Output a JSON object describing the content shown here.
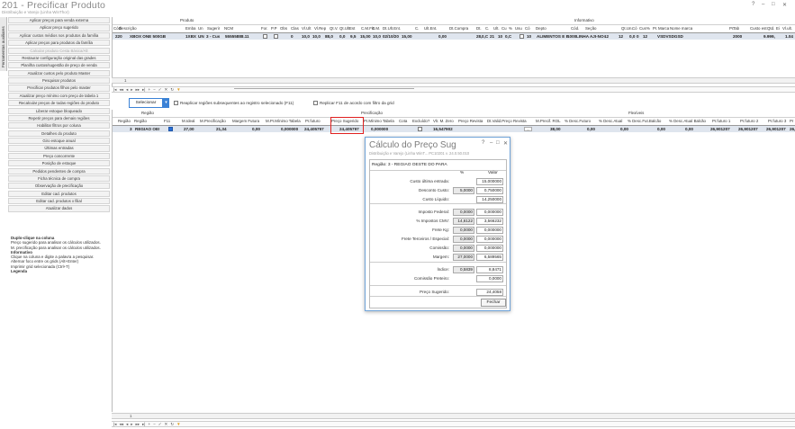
{
  "app": {
    "title": "201 - Precificar Produto",
    "subtitle": "Distribuição e Varejo (Linha WinThor)",
    "help_icon": "?",
    "ctrl_min": "–",
    "ctrl_max": "□",
    "ctrl_close": "✕"
  },
  "side_tab": "Ferramentas auxiliares",
  "sidebar": {
    "items": [
      {
        "label": "Aplicar preços para venda externa",
        "enabled": true
      },
      {
        "label": "Aplicar preço sugerido",
        "enabled": true
      },
      {
        "label": "Aplicar custos médios nos produtos da família",
        "enabled": true
      },
      {
        "label": "Aplicar preços para produtos da família",
        "enabled": true
      },
      {
        "label": "Calcular produto Cesta Básica/Alt",
        "enabled": false
      },
      {
        "label": "Restaurar configuração original das grades",
        "enabled": true
      },
      {
        "label": "Planilha custos/sugestão de preço de venda",
        "enabled": true
      },
      {
        "label": "Atualizar custos pelo produto Master",
        "enabled": true
      },
      {
        "label": "Pesquisar produtos",
        "enabled": true
      },
      {
        "label": "Precificar produtos filhos pelo master",
        "enabled": true
      },
      {
        "label": "Atualizar preço mínimo com preço de tabela 1",
        "enabled": true
      },
      {
        "label": "Recalcular preços de todas regiões do produto",
        "enabled": true
      },
      {
        "label": "Liberar estoque bloqueado",
        "enabled": true
      },
      {
        "label": "Repetir preços para demais regiões",
        "enabled": true
      },
      {
        "label": "Habilitar filtros por coluna",
        "enabled": true
      },
      {
        "label": "Detalhes do produto",
        "enabled": true
      },
      {
        "label": "Giro estoque anual",
        "enabled": true
      },
      {
        "label": "Últimas entradas",
        "enabled": true
      },
      {
        "label": "Preço concorrente",
        "enabled": true
      },
      {
        "label": "Posição de estoque",
        "enabled": true
      },
      {
        "label": "Pedidos pendentes de compra",
        "enabled": true
      },
      {
        "label": "Ficha técnica de compra",
        "enabled": true
      },
      {
        "label": "Observação de precificação",
        "enabled": true
      },
      {
        "label": "Editar cad. produtos",
        "enabled": true
      },
      {
        "label": "Editar cad. produtos x filial",
        "enabled": true
      },
      {
        "label": "Atualizar dados",
        "enabled": true
      }
    ],
    "help_title": "Duplo-clique na coluna",
    "help_line1": "Preço sugerido para analisar os cálculos utilizados.",
    "help_line2": "M. precificação para analisar os cálculos utilizados.",
    "info_title": "Informativo",
    "info_line1": "Clique na coluna e digite a palavra a pesquisar.",
    "info_line2": "Alternar foco entre os grids (Alt+Enter)",
    "info_line3": "Imprimir grid selecionada (Ctrl+T)",
    "legend_title": "Legenda"
  },
  "product_grid": {
    "group_produto": "Produto",
    "group_informativo": "Informativo",
    "headers": [
      "Códi",
      "Descrição",
      "Emba",
      "Un",
      "Sugerir",
      "NCM",
      "For.",
      "P.P",
      "Obs",
      "Clas",
      "Vl.Ult",
      "Vl.Rep",
      "Qt.V.",
      "Qt.Ult",
      "Est",
      "C.M.Fin",
      "C.M.",
      "Dt.Ult.Ent.",
      "C.",
      "Ult.Ent.",
      "Dt.Compra",
      "Dt.",
      "C.",
      "Ult.",
      "Cu",
      "%",
      "Usu",
      "Có",
      "Depto",
      "Cód.",
      "Seção",
      "Qt.Un.",
      "Có",
      "Cus",
      "%",
      "Pr.",
      "Marca",
      "Nome marca",
      "Pr.",
      "Tab",
      "Custo est",
      "Qtd.",
      "Ei",
      "Vl.ult."
    ],
    "row": [
      "220",
      "XBOX ONE 500GB",
      "1XBX",
      "UN",
      "3 - Cus",
      "55555888.11",
      "0",
      "10,0",
      "10,0",
      "88,0",
      "0,0",
      "9,5",
      "15,00",
      "10,0",
      "02/10/20",
      "15,00",
      "0,00",
      "28,",
      "0,C",
      "21",
      "10",
      "0,C",
      "10",
      "ALIMENTOS E E",
      "1000",
      "LINHA AJI-NO-",
      "12",
      "12",
      "0,0",
      "0",
      "12",
      "VSDVSDGSD",
      "2000",
      "9.999,",
      "1.04"
    ],
    "nav_count": "1"
  },
  "options": {
    "button": "Selecionar",
    "dropdown_arrow": "▾",
    "opt1": "Reaplicar regiões subsequentes ao registro selecionado (F11)",
    "opt2": "Replicar F11 de acordo com filtro da grid"
  },
  "region_grid": {
    "group_regiao": "Região",
    "group_precificacao": "Precificação",
    "group_flexiveis": "Flexíveis",
    "headers": [
      "Região",
      "Região",
      "F11",
      "M.Ideal",
      "M.Precificação",
      "Margem Futura",
      "M.Pr.Mínimo Tabela",
      "Pr.futuro",
      "Preço Sugerido",
      "Pr.Mínimo Tabela",
      "Cota",
      "Excluído?",
      "Vlr. M. Zero",
      "Preço Revista",
      "Dt.Valid.Preço Revista",
      "M.Precif. ROL",
      "% Desc.Futuro",
      "% Desc.Atual",
      "% Desc.Fut.Balcão",
      "% Desc.Atual Balcão",
      "Pr.futuro 1",
      "Pr.futuro 2",
      "Pr.futuro 3",
      "Pr"
    ],
    "row": [
      "3",
      "REGIAO OE!",
      "27,00",
      "21,34",
      "0,00",
      "0,000000",
      "24,405797",
      "24,405797",
      "0,000000",
      "16,547902",
      "38,00",
      "0,00",
      "0,00",
      "0,00",
      "0,00",
      "26,901207",
      "26,901207",
      "26,901207",
      "26,"
    ],
    "nav_count": "1"
  },
  "dialog": {
    "title": "Cálculo do Preço Sug",
    "subtitle": "Distribuição e Varejo (Linha WinT...",
    "code": "PC10201",
    "version": "v. 24.0.50.010",
    "region_label": "Região: 3 - REGIAO OESTE DO PARA",
    "col_pct": "%",
    "col_valor": "Valor",
    "rows": [
      {
        "label": "Custo última entrada:",
        "pct": "",
        "valor": "15,000000"
      },
      {
        "label": "Desconto Custo:",
        "pct": "5,0000",
        "valor": "0,750000"
      },
      {
        "label": "Custo Líquido:",
        "pct": "",
        "valor": "14,250000"
      },
      {
        "label": "Imposto Federal:",
        "pct": "0,0000",
        "valor": "0,000000"
      },
      {
        "label": "% Impostos CMV:",
        "pct": "14,6122",
        "valor": "3,566232"
      },
      {
        "label": "Frete Kg:",
        "pct": "0,0000",
        "valor": "0,000000"
      },
      {
        "label": "Frete Terceiros / Especial:",
        "pct": "0,0000",
        "valor": "0,000000"
      },
      {
        "label": "Comissão:",
        "pct": "0,0000",
        "valor": "0,000000"
      },
      {
        "label": "Margem:",
        "pct": "27,0000",
        "valor": "6,589565"
      },
      {
        "label": "Índice:",
        "pct": "0,5839",
        "valor": "8,8471"
      },
      {
        "label": "Comissão Preteiro:",
        "pct": "",
        "valor": "0,0000"
      },
      {
        "label": "Preço Sugerido:",
        "pct": "",
        "valor": "24,4058"
      }
    ],
    "close_button": "Fechar"
  },
  "colors": {
    "accent": "#3b82d6",
    "highlight_border": "#e02020",
    "selected_row": "#dfe5ee"
  }
}
